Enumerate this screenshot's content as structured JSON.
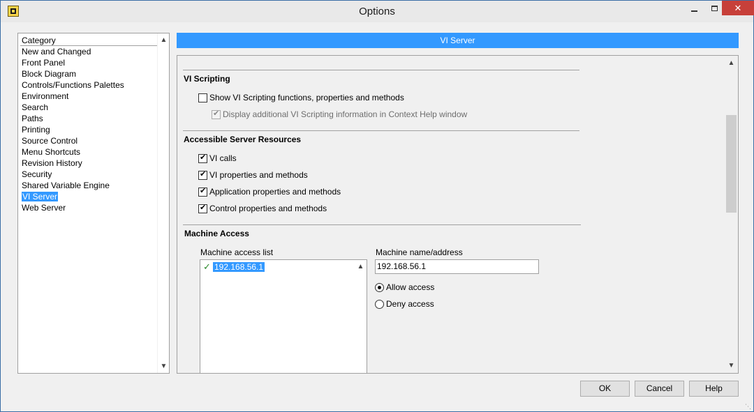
{
  "window": {
    "title": "Options"
  },
  "categories": {
    "header": "Category",
    "items": [
      "New and Changed",
      "Front Panel",
      "Block Diagram",
      "Controls/Functions Palettes",
      "Environment",
      "Search",
      "Paths",
      "Printing",
      "Source Control",
      "Menu Shortcuts",
      "Revision History",
      "Security",
      "Shared Variable Engine",
      "VI Server",
      "Web Server"
    ],
    "selected": "VI Server"
  },
  "panel": {
    "title": "VI Server"
  },
  "scripting": {
    "title": "VI Scripting",
    "show_label": "Show VI Scripting functions, properties and methods",
    "show_checked": false,
    "display_label": "Display additional VI Scripting information in Context Help window",
    "display_checked": true
  },
  "resources": {
    "title": "Accessible Server Resources",
    "vi_calls": "VI calls",
    "vi_props": "VI properties and methods",
    "app_props": "Application properties and methods",
    "control_props": "Control properties and methods"
  },
  "machine": {
    "title": "Machine Access",
    "list_label": "Machine access list",
    "list_item": "192.168.56.1",
    "name_label": "Machine name/address",
    "name_value": "192.168.56.1",
    "allow_label": "Allow access",
    "deny_label": "Deny access",
    "selected_access": "allow"
  },
  "buttons": {
    "ok": "OK",
    "cancel": "Cancel",
    "help": "Help"
  }
}
